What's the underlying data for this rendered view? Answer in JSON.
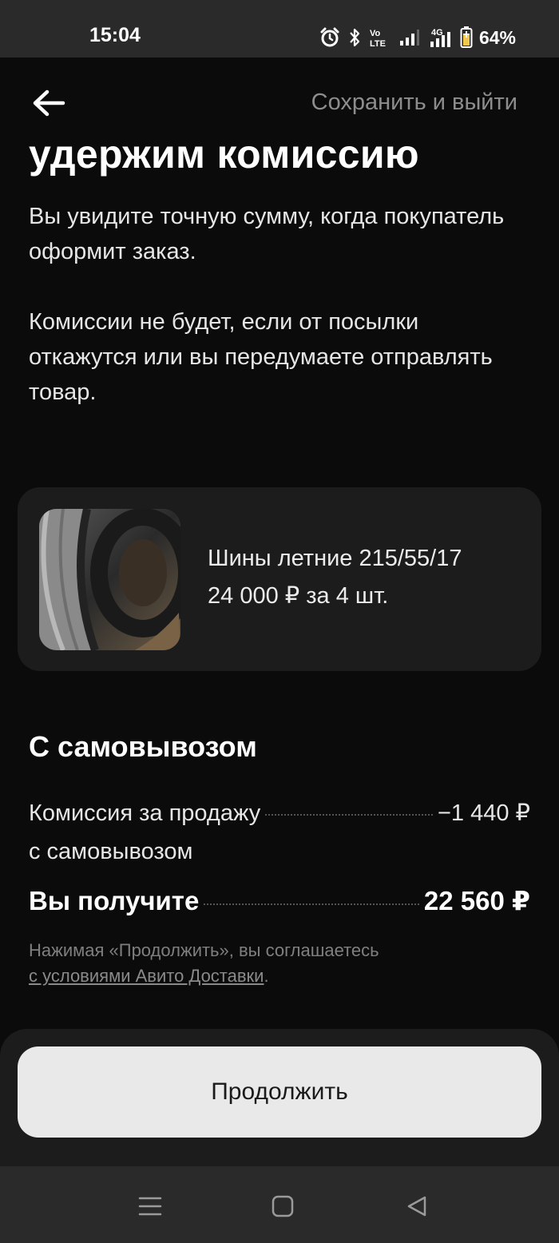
{
  "status_bar": {
    "time": "15:04",
    "battery_percent": "64%",
    "icons": [
      "alarm-icon",
      "bluetooth-icon",
      "volte-icon",
      "signal-icon",
      "4g-signal-icon",
      "battery-icon"
    ]
  },
  "header": {
    "back_icon": "arrow-left-icon",
    "save_exit_label": "Сохранить и выйти"
  },
  "main": {
    "heading": "удержим комиссию",
    "paragraph_1": "Вы увидите точную сумму, когда покупатель оформит заказ.",
    "paragraph_2": "Комиссии не будет, если от посылки откажутся или вы передумаете отправлять товар."
  },
  "product": {
    "title": "Шины летние 215/55/17",
    "price": "24 000 ₽ за 4 шт."
  },
  "summary": {
    "section_title": "С самовывозом",
    "commission_label": "Комиссия за продажу",
    "commission_label_line2": "с самовывозом",
    "commission_value": "−1 440 ₽",
    "receive_label": "Вы получите",
    "receive_value": "22 560 ₽"
  },
  "agreement": {
    "text": "Нажимая «Продолжить», вы соглашаетесь",
    "link_text": "с условиями Авито Доставки",
    "suffix": "."
  },
  "cta": {
    "continue_label": "Продолжить"
  },
  "nav_bar": {
    "icons": [
      "menu-icon",
      "home-icon",
      "back-icon"
    ]
  }
}
